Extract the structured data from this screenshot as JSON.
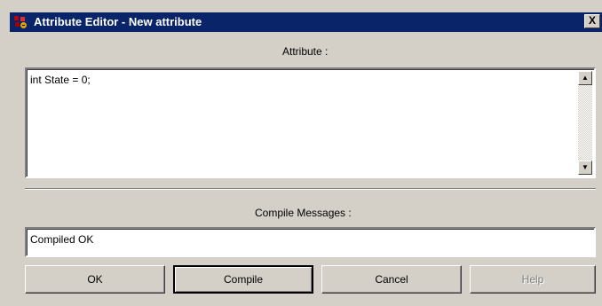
{
  "window": {
    "title": "Attribute Editor - New attribute",
    "close_glyph": "X",
    "icon": "app-icon"
  },
  "attribute": {
    "label": "Attribute :",
    "value": "int State = 0;",
    "scroll_up_glyph": "▲",
    "scroll_down_glyph": "▼"
  },
  "messages": {
    "label": "Compile Messages :",
    "value": "Compiled OK"
  },
  "buttons": {
    "ok": "OK",
    "compile": "Compile",
    "cancel": "Cancel",
    "help": "Help"
  },
  "colors": {
    "titlebar": "#0a246a",
    "face": "#d4d0c8"
  }
}
